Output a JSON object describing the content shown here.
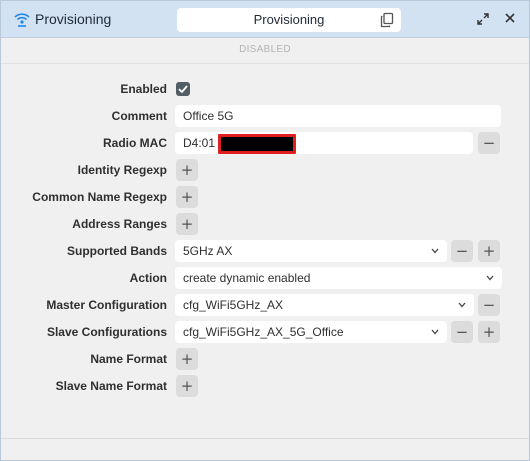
{
  "window": {
    "title": "Provisioning",
    "center_title": "Provisioning"
  },
  "status": {
    "text": "DISABLED"
  },
  "form": {
    "enabled": {
      "label": "Enabled",
      "checked": true
    },
    "comment": {
      "label": "Comment",
      "value": "Office 5G"
    },
    "radio_mac": {
      "label": "Radio MAC",
      "value": "D4:01"
    },
    "identity_regexp": {
      "label": "Identity Regexp"
    },
    "common_name_regexp": {
      "label": "Common Name Regexp"
    },
    "address_ranges": {
      "label": "Address Ranges"
    },
    "supported_bands": {
      "label": "Supported Bands",
      "value": "5GHz AX"
    },
    "action": {
      "label": "Action",
      "value": "create dynamic enabled"
    },
    "master_configuration": {
      "label": "Master Configuration",
      "value": "cfg_WiFi5GHz_AX"
    },
    "slave_configurations": {
      "label": "Slave Configurations",
      "value": "cfg_WiFi5GHz_AX_5G_Office"
    },
    "name_format": {
      "label": "Name Format"
    },
    "slave_name_format": {
      "label": "Slave Name Format"
    }
  },
  "buttons": {
    "add": "+",
    "remove": "−"
  },
  "colors": {
    "titlebar": "#d2e2f2",
    "accent": "#1e88e5",
    "redaction_border": "#e02020"
  },
  "icons": {
    "title": "wifi-provisioning-icon",
    "copy": "copy-icon",
    "expand": "expand-icon",
    "close": "close-icon"
  }
}
